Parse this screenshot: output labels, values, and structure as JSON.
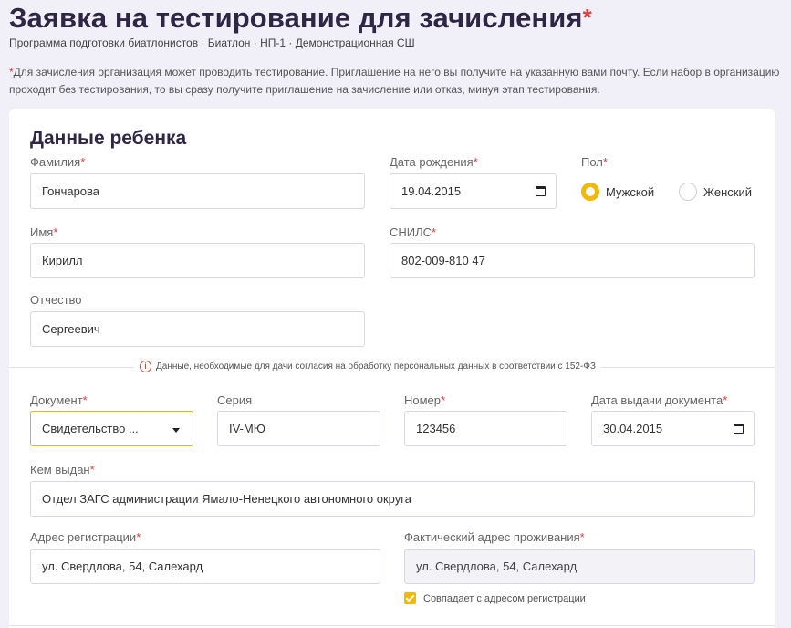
{
  "header": {
    "title": "Заявка на тестирование для зачисления",
    "title_required_mark": "*",
    "subtitle": "Программа подготовки биатлонистов · Биатлон · НП-1 · Демонстрационная СШ"
  },
  "notice": {
    "mark": "*",
    "text": "Для зачисления организация может проводить тестирование. Приглашение на него вы получите на указанную вами почту. Если набор в организацию проходит без тестирования, то вы сразу получите приглашение на зачисление или отказ, минуя этап тестирования."
  },
  "child": {
    "section_title": "Данные ребенка",
    "surname": {
      "label": "Фамилия",
      "required": "*",
      "value": "Гончарова"
    },
    "birth_date": {
      "label": "Дата рождения",
      "required": "*",
      "value": "19.04.2015"
    },
    "gender": {
      "label": "Пол",
      "required": "*",
      "options": [
        "Мужской",
        "Женский"
      ],
      "selected": "Мужской"
    },
    "name": {
      "label": "Имя",
      "required": "*",
      "value": "Кирилл"
    },
    "snils": {
      "label": "СНИЛС",
      "required": "*",
      "value": "802-009-810 47"
    },
    "patronymic": {
      "label": "Отчество",
      "value": "Сергеевич"
    }
  },
  "consent_note": "Данные, необходимые для дачи согласия на обработку персональных данных в соответствии с 152-ФЗ",
  "document": {
    "type": {
      "label": "Документ",
      "required": "*",
      "value": "Свидетельство ..."
    },
    "series": {
      "label": "Серия",
      "value": "IV-МЮ"
    },
    "number": {
      "label": "Номер",
      "required": "*",
      "value": "123456"
    },
    "issue_date": {
      "label": "Дата выдачи документа",
      "required": "*",
      "value": "30.04.2015"
    },
    "issued_by": {
      "label": "Кем выдан",
      "required": "*",
      "value": "Отдел ЗАГС администрации Ямало-Ненецкого автономного округа"
    }
  },
  "address": {
    "registration": {
      "label": "Адрес регистрации",
      "required": "*",
      "value": "ул. Свердлова, 54, Салехард"
    },
    "actual": {
      "label": "Фактический адрес проживания",
      "required": "*",
      "value": "ул. Свердлова, 54, Салехард"
    },
    "same_as_registration_label": "Совпадает с адресом регистрации"
  },
  "colors": {
    "accent": "#f2b900",
    "required": "#e03c3c",
    "title": "#2f2545",
    "background": "#f1f0f8"
  }
}
